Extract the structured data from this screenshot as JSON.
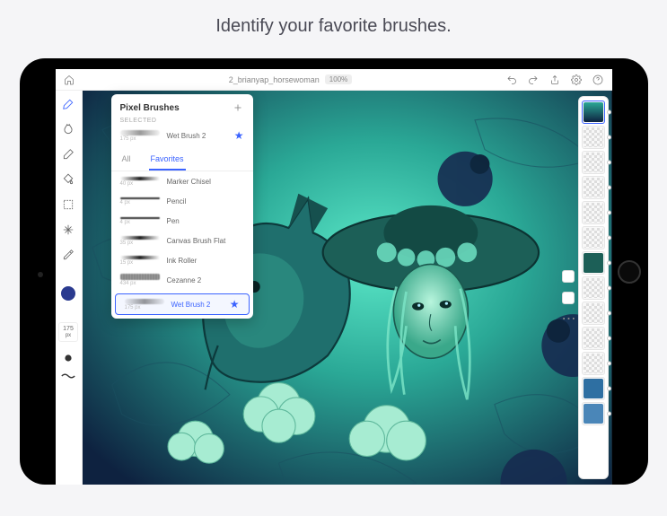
{
  "page": {
    "headline": "Identify your favorite brushes."
  },
  "header": {
    "filename": "2_brianyap_horsewoman",
    "zoom": "100%"
  },
  "brush_panel": {
    "title": "Pixel Brushes",
    "selected_label": "SELECTED",
    "selected": {
      "name": "Wet Brush 2",
      "size": "175 px"
    },
    "tabs": {
      "all": "All",
      "favorites": "Favorites"
    },
    "brushes": [
      {
        "name": "Marker Chisel",
        "size": "40 px"
      },
      {
        "name": "Pencil",
        "size": "4 px"
      },
      {
        "name": "Pen",
        "size": "4 px"
      },
      {
        "name": "Canvas Brush Flat",
        "size": "35 px"
      },
      {
        "name": "Ink Roller",
        "size": "15 px"
      },
      {
        "name": "Cezanne 2",
        "size": "434 px"
      },
      {
        "name": "Wet Brush 2",
        "size": "175 px"
      }
    ]
  },
  "left_tools": {
    "size_value": "175",
    "size_unit": "px"
  },
  "layers": {
    "count": 13
  }
}
